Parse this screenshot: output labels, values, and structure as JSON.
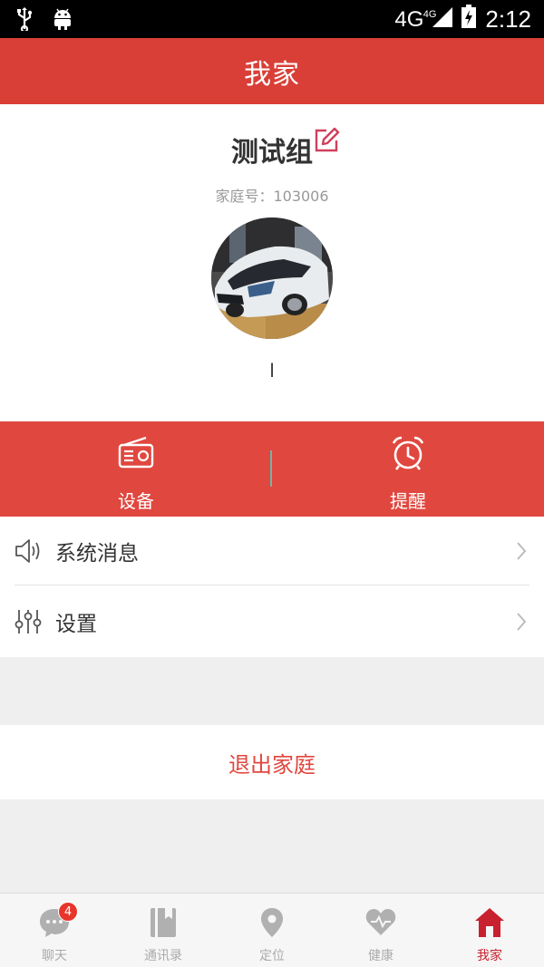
{
  "status_bar": {
    "network": "4G",
    "network_small": "4G",
    "time": "2:12",
    "left_icons": [
      "usb-icon",
      "android-icon"
    ]
  },
  "header": {
    "title": "我家"
  },
  "profile": {
    "group_name": "测试组",
    "family_id_label": "家庭号：103006",
    "member_name": "l"
  },
  "actions": [
    {
      "label": "设备",
      "icon": "radio-icon"
    },
    {
      "label": "提醒",
      "icon": "alarm-clock-icon"
    }
  ],
  "menu": [
    {
      "label": "系统消息",
      "icon": "speaker-icon"
    },
    {
      "label": "设置",
      "icon": "sliders-icon"
    }
  ],
  "exit": {
    "label": "退出家庭"
  },
  "tabs": [
    {
      "label": "聊天",
      "icon": "chat-icon",
      "badge": "4"
    },
    {
      "label": "通讯录",
      "icon": "contacts-icon"
    },
    {
      "label": "定位",
      "icon": "location-pin-icon"
    },
    {
      "label": "健康",
      "icon": "heart-icon"
    },
    {
      "label": "我家",
      "icon": "home-icon",
      "active": true
    }
  ],
  "colors": {
    "primary_red": "#d93f37",
    "action_red": "#e0473f",
    "active_tab": "#c8202f",
    "inactive_tab": "#aaaaaa"
  }
}
